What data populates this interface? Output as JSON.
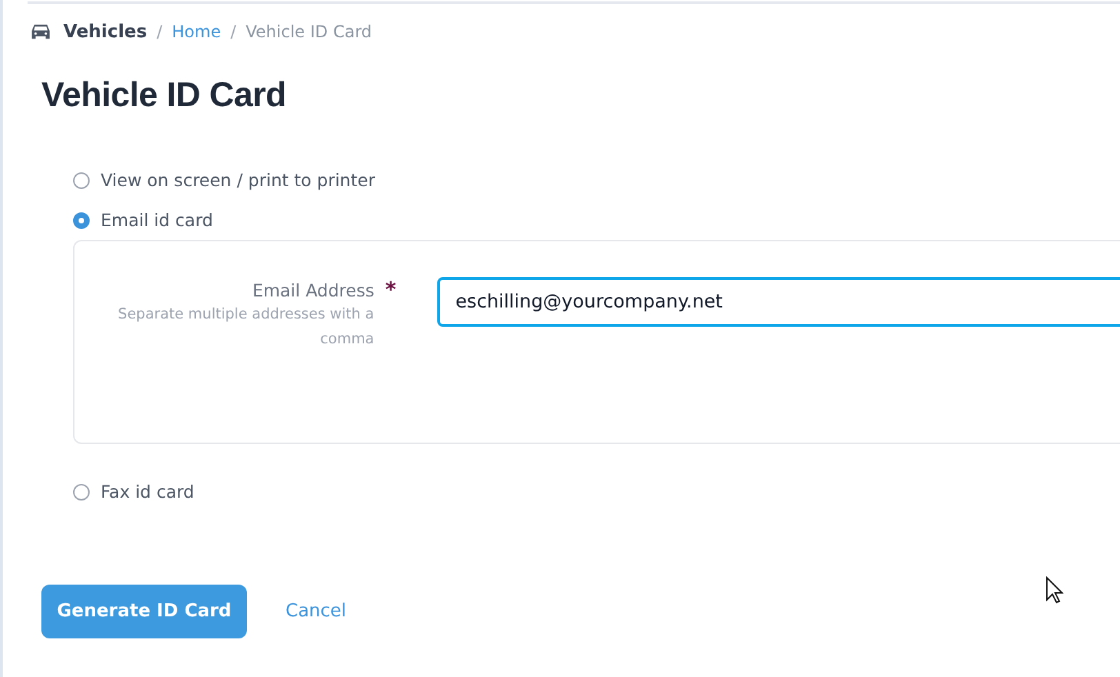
{
  "breadcrumb": {
    "section": "Vehicles",
    "separator": "/",
    "items": [
      {
        "label": "Home",
        "kind": "link"
      },
      {
        "label": "Vehicle ID Card",
        "kind": "current"
      }
    ]
  },
  "title": "Vehicle ID Card",
  "options": [
    {
      "label": "View on screen / print to printer",
      "selected": false
    },
    {
      "label": "Email id card",
      "selected": true,
      "panel": {
        "label": "Email Address",
        "required_mark": "*",
        "help": "Separate multiple addresses with a comma",
        "value": "eschilling@yourcompany.net",
        "focused": true
      }
    },
    {
      "label": "Fax id card",
      "selected": false
    }
  ],
  "buttons": {
    "primary": "Generate ID Card",
    "cancel": "Cancel"
  }
}
